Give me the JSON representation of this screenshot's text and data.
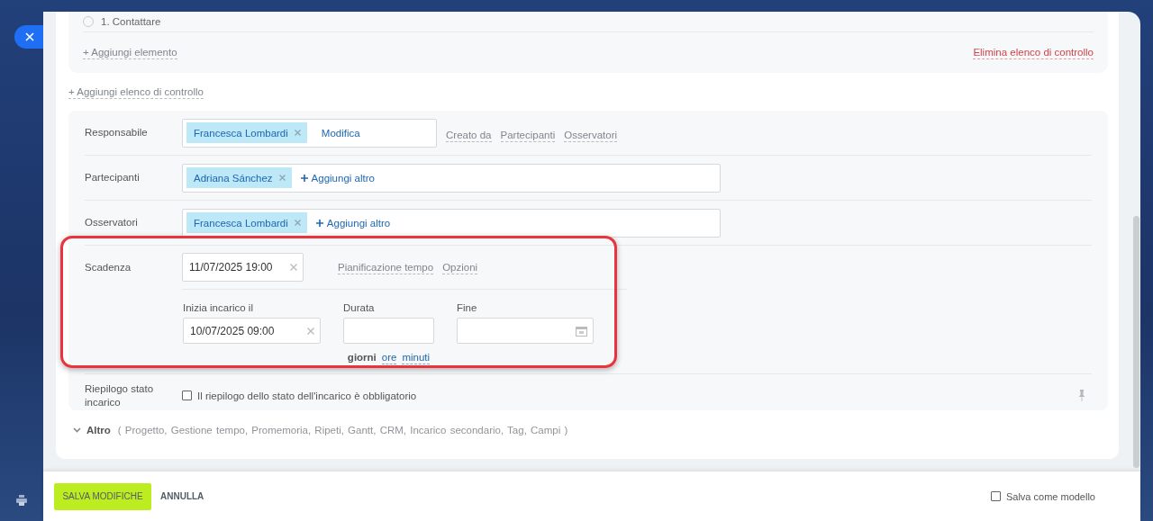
{
  "checklist": {
    "items": [
      {
        "label": "1. Contattare",
        "checked": false
      }
    ],
    "add_item": "+ Aggiungi elemento",
    "delete": "Elimina elenco di controllo"
  },
  "add_checklist": "+ Aggiungi elenco di controllo",
  "people": [
    {
      "label": "Responsabile",
      "tags": [
        "Francesca Lombardi"
      ],
      "action": "Modifica",
      "kind": "edit",
      "links": [
        "Creato da",
        "Partecipanti",
        "Osservatori"
      ]
    },
    {
      "label": "Partecipanti",
      "tags": [
        "Adriana Sánchez"
      ],
      "action": "Aggiungi altro",
      "kind": "add"
    },
    {
      "label": "Osservatori",
      "tags": [
        "Francesca Lombardi"
      ],
      "action": "Aggiungi altro",
      "kind": "add"
    }
  ],
  "deadline": {
    "label": "Scadenza",
    "value": "11/07/2025 19:00",
    "links": [
      "Pianificazione tempo",
      "Opzioni"
    ],
    "start": {
      "label": "Inizia incarico il",
      "value": "10/07/2025 09:00"
    },
    "duration": {
      "label": "Durata",
      "units": [
        {
          "label": "giorni",
          "selected": true
        },
        {
          "label": "ore",
          "selected": false
        },
        {
          "label": "minuti",
          "selected": false
        }
      ]
    },
    "end": {
      "label": "Fine"
    }
  },
  "summary": {
    "label": "Riepilogo stato incarico",
    "text": "Il riepilogo dello stato dell'incarico è obbligatorio",
    "checked": false
  },
  "more": {
    "label": "Altro",
    "expanded": false,
    "items": "( Progetto,  Gestione tempo,  Promemoria,  Ripeti,  Gantt,  CRM,  Incarico secondario,  Tag,  Campi )"
  },
  "footer": {
    "save": "SALVA MODIFICHE",
    "cancel": "ANNULLA",
    "template": "Salva come modello",
    "template_checked": false
  }
}
